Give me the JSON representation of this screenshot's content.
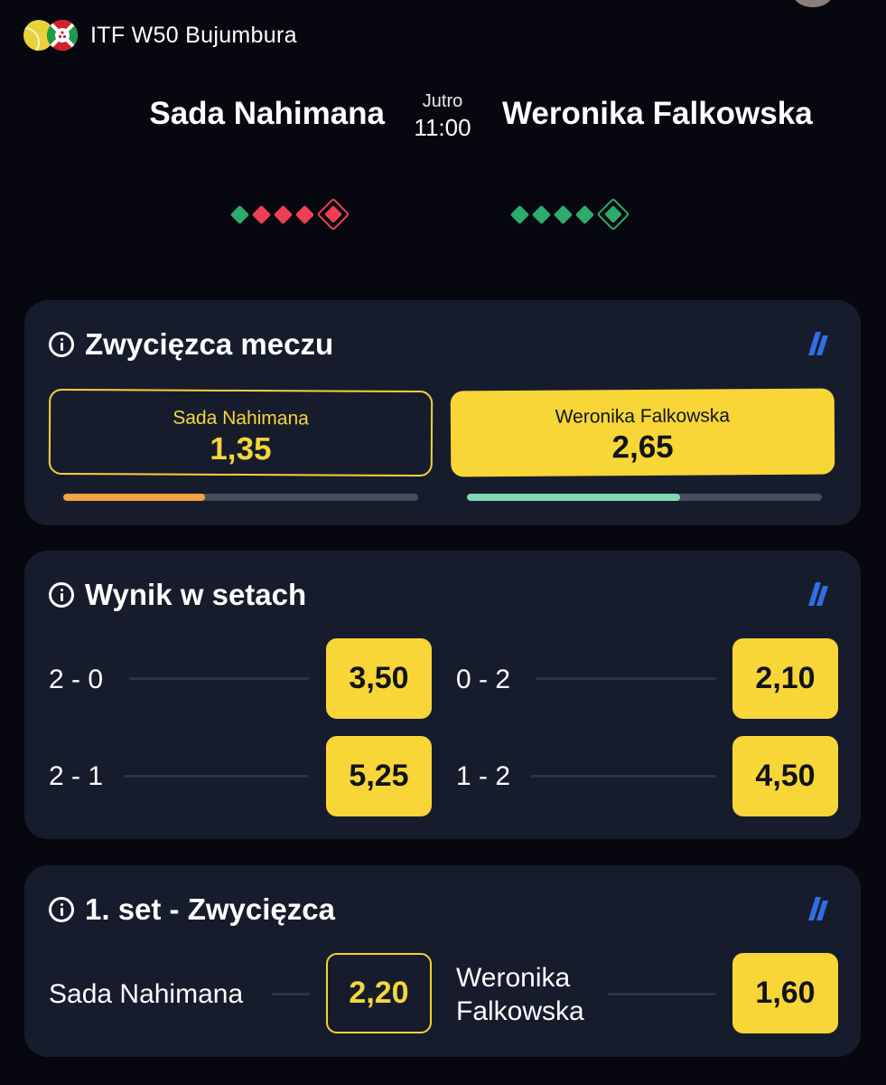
{
  "header": {
    "tournament": "ITF W50 Bujumbura",
    "sport_icon": "tennis-ball-icon",
    "country_icon": "burundi-flag-icon"
  },
  "match": {
    "player1": "Sada Nahimana",
    "player2": "Weronika Falkowska",
    "day": "Jutro",
    "time": "11:00",
    "form1": [
      "W",
      "L",
      "L",
      "L",
      "L"
    ],
    "form2": [
      "W",
      "W",
      "W",
      "W",
      "W"
    ]
  },
  "colors": {
    "accent_yellow": "#f8d638",
    "win_green": "#2daa6e",
    "loss_red": "#ee3f55",
    "card_bg": "#171c2c",
    "boost_blue": "#2f6fe6"
  },
  "market_winner": {
    "title": "Zwycięzca meczu",
    "option1": {
      "name": "Sada Nahimana",
      "odds": "1,35",
      "share": 0.4,
      "bar_color": "#f0a33e"
    },
    "option2": {
      "name": "Weronika Falkowska",
      "odds": "2,65",
      "share": 0.6,
      "bar_color": "#7fd9b6"
    }
  },
  "market_sets": {
    "title": "Wynik w setach",
    "rows": [
      {
        "left_label": "2 - 0",
        "left_odds": "3,50",
        "right_label": "0 - 2",
        "right_odds": "2,10"
      },
      {
        "left_label": "2 - 1",
        "left_odds": "5,25",
        "right_label": "1 - 2",
        "right_odds": "4,50"
      }
    ]
  },
  "market_first_set": {
    "title": "1. set - Zwycięzca",
    "left_label": "Sada Nahimana",
    "left_odds": "2,20",
    "right_label_line1": "Weronika",
    "right_label_line2": "Falkowska",
    "right_odds": "1,60"
  }
}
